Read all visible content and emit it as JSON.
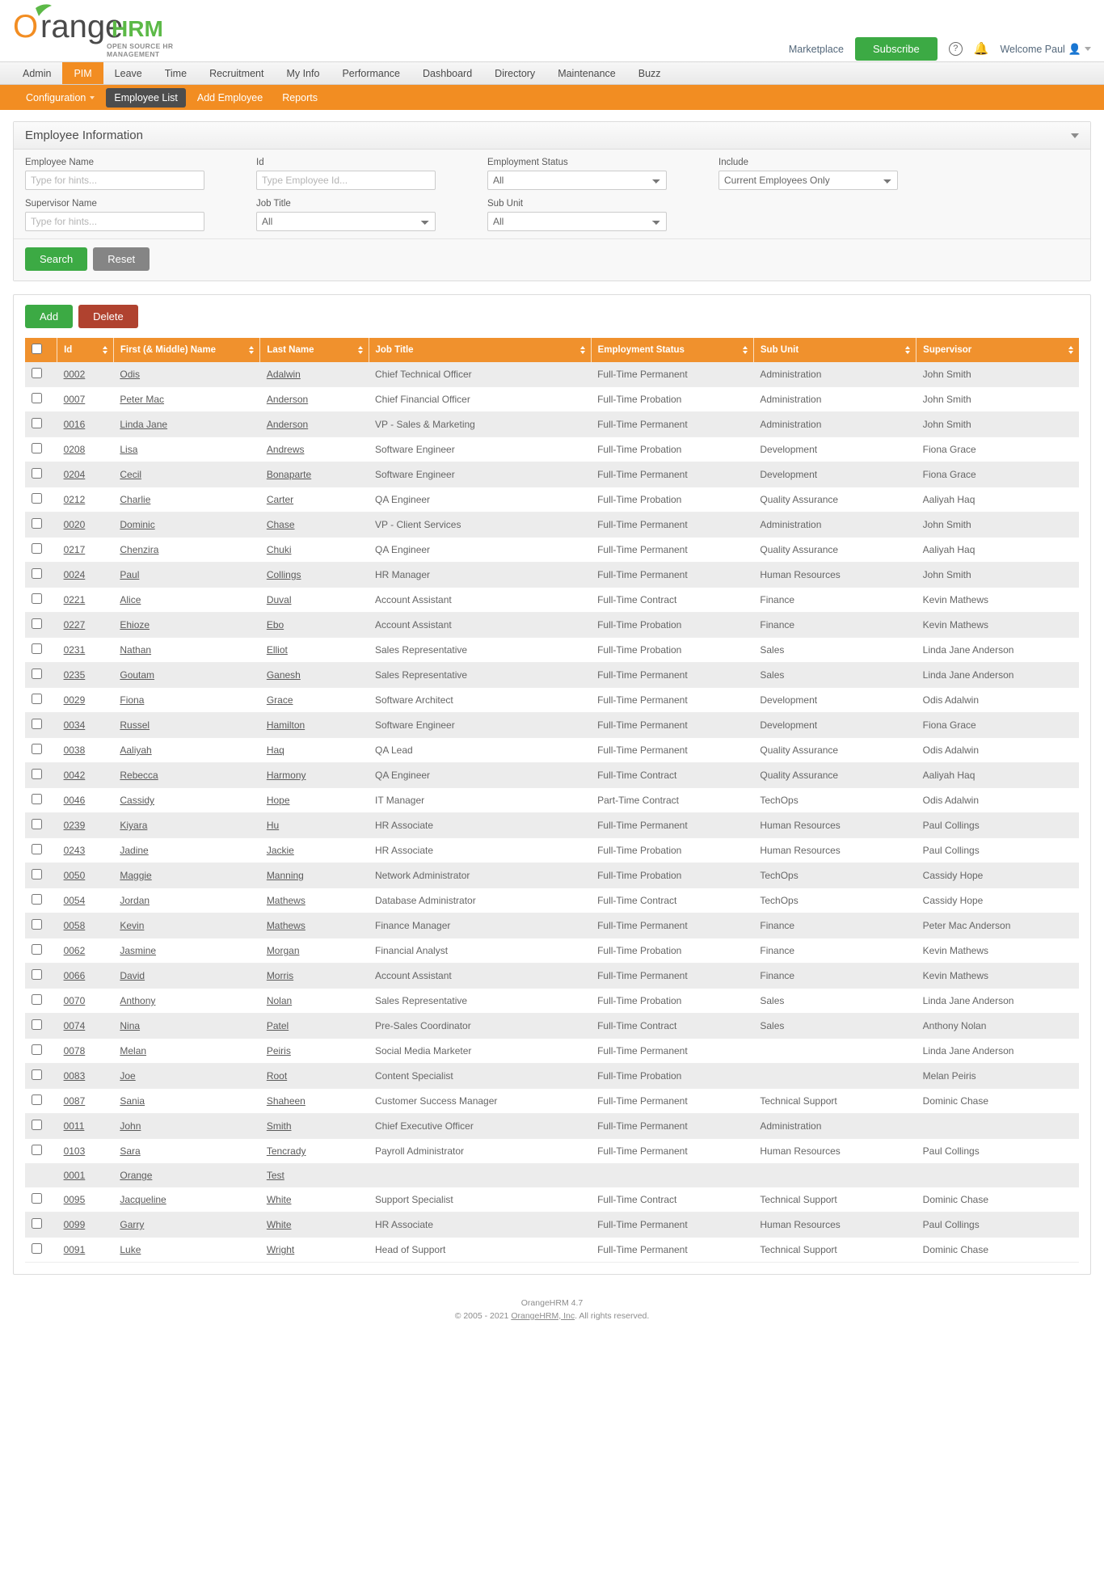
{
  "header": {
    "logo_text_orange": "range",
    "logo_text_o": "O",
    "logo_text_hrm": "HRM",
    "logo_tagline": "OPEN SOURCE HR MANAGEMENT",
    "marketplace": "Marketplace",
    "subscribe": "Subscribe",
    "help_icon": "?",
    "bell_icon": "ὑ4",
    "welcome": "Welcome Paul",
    "colors": {
      "orange": "#f28d22",
      "green": "#3caa44",
      "red": "#b0422f"
    }
  },
  "main_nav": {
    "items": [
      {
        "label": "Admin",
        "active": false
      },
      {
        "label": "PIM",
        "active": true
      },
      {
        "label": "Leave",
        "active": false
      },
      {
        "label": "Time",
        "active": false
      },
      {
        "label": "Recruitment",
        "active": false
      },
      {
        "label": "My Info",
        "active": false
      },
      {
        "label": "Performance",
        "active": false
      },
      {
        "label": "Dashboard",
        "active": false
      },
      {
        "label": "Directory",
        "active": false
      },
      {
        "label": "Maintenance",
        "active": false
      },
      {
        "label": "Buzz",
        "active": false
      }
    ]
  },
  "sub_nav": {
    "items": [
      {
        "label": "Configuration",
        "active": false,
        "caret": true
      },
      {
        "label": "Employee List",
        "active": true,
        "caret": false
      },
      {
        "label": "Add Employee",
        "active": false,
        "caret": false
      },
      {
        "label": "Reports",
        "active": false,
        "caret": false
      }
    ]
  },
  "search_panel": {
    "title": "Employee Information",
    "fields": {
      "employee_name": {
        "label": "Employee Name",
        "placeholder": "Type for hints...",
        "value": ""
      },
      "id": {
        "label": "Id",
        "placeholder": "Type Employee Id...",
        "value": ""
      },
      "employment_status": {
        "label": "Employment Status",
        "value": "All"
      },
      "include": {
        "label": "Include",
        "value": "Current Employees Only"
      },
      "supervisor_name": {
        "label": "Supervisor Name",
        "placeholder": "Type for hints...",
        "value": ""
      },
      "job_title": {
        "label": "Job Title",
        "value": "All"
      },
      "sub_unit": {
        "label": "Sub Unit",
        "value": "All"
      }
    },
    "search_label": "Search",
    "reset_label": "Reset"
  },
  "list_panel": {
    "add_label": "Add",
    "delete_label": "Delete",
    "columns": [
      {
        "key": "check",
        "label": ""
      },
      {
        "key": "id",
        "label": "Id",
        "sortable": true
      },
      {
        "key": "first",
        "label": "First (& Middle) Name",
        "sortable": true
      },
      {
        "key": "last",
        "label": "Last Name",
        "sortable": true
      },
      {
        "key": "job",
        "label": "Job Title",
        "sortable": true
      },
      {
        "key": "employment_status",
        "label": "Employment Status",
        "sortable": true
      },
      {
        "key": "sub_unit",
        "label": "Sub Unit",
        "sortable": true
      },
      {
        "key": "supervisor",
        "label": "Supervisor",
        "sortable": true
      }
    ],
    "rows": [
      {
        "id": "0002",
        "first": "Odis",
        "last": "Adalwin",
        "job": "Chief Technical Officer",
        "employment_status": "Full-Time Permanent",
        "sub_unit": "Administration",
        "supervisor": "John Smith",
        "checkbox": true
      },
      {
        "id": "0007",
        "first": "Peter Mac",
        "last": "Anderson",
        "job": "Chief Financial Officer",
        "employment_status": "Full-Time Probation",
        "sub_unit": "Administration",
        "supervisor": "John Smith",
        "checkbox": true
      },
      {
        "id": "0016",
        "first": "Linda Jane",
        "last": "Anderson",
        "job": "VP - Sales & Marketing",
        "employment_status": "Full-Time Permanent",
        "sub_unit": "Administration",
        "supervisor": "John Smith",
        "checkbox": true
      },
      {
        "id": "0208",
        "first": "Lisa",
        "last": "Andrews",
        "job": "Software Engineer",
        "employment_status": "Full-Time Probation",
        "sub_unit": "Development",
        "supervisor": "Fiona Grace",
        "checkbox": true
      },
      {
        "id": "0204",
        "first": "Cecil",
        "last": "Bonaparte",
        "job": "Software Engineer",
        "employment_status": "Full-Time Permanent",
        "sub_unit": "Development",
        "supervisor": "Fiona Grace",
        "checkbox": true
      },
      {
        "id": "0212",
        "first": "Charlie",
        "last": "Carter",
        "job": "QA Engineer",
        "employment_status": "Full-Time Probation",
        "sub_unit": "Quality Assurance",
        "supervisor": "Aaliyah Haq",
        "checkbox": true
      },
      {
        "id": "0020",
        "first": "Dominic",
        "last": "Chase",
        "job": "VP - Client Services",
        "employment_status": "Full-Time Permanent",
        "sub_unit": "Administration",
        "supervisor": "John Smith",
        "checkbox": true
      },
      {
        "id": "0217",
        "first": "Chenzira",
        "last": "Chuki",
        "job": "QA Engineer",
        "employment_status": "Full-Time Permanent",
        "sub_unit": "Quality Assurance",
        "supervisor": "Aaliyah Haq",
        "checkbox": true
      },
      {
        "id": "0024",
        "first": "Paul",
        "last": "Collings",
        "job": "HR Manager",
        "employment_status": "Full-Time Permanent",
        "sub_unit": "Human Resources",
        "supervisor": "John Smith",
        "checkbox": true
      },
      {
        "id": "0221",
        "first": "Alice",
        "last": "Duval",
        "job": "Account Assistant",
        "employment_status": "Full-Time Contract",
        "sub_unit": "Finance",
        "supervisor": "Kevin Mathews",
        "checkbox": true
      },
      {
        "id": "0227",
        "first": "Ehioze",
        "last": "Ebo",
        "job": "Account Assistant",
        "employment_status": "Full-Time Probation",
        "sub_unit": "Finance",
        "supervisor": "Kevin Mathews",
        "checkbox": true
      },
      {
        "id": "0231",
        "first": "Nathan",
        "last": "Elliot",
        "job": "Sales Representative",
        "employment_status": "Full-Time Probation",
        "sub_unit": "Sales",
        "supervisor": "Linda Jane Anderson",
        "checkbox": true
      },
      {
        "id": "0235",
        "first": "Goutam",
        "last": "Ganesh",
        "job": "Sales Representative",
        "employment_status": "Full-Time Permanent",
        "sub_unit": "Sales",
        "supervisor": "Linda Jane Anderson",
        "checkbox": true
      },
      {
        "id": "0029",
        "first": "Fiona",
        "last": "Grace",
        "job": "Software Architect",
        "employment_status": "Full-Time Permanent",
        "sub_unit": "Development",
        "supervisor": "Odis Adalwin",
        "checkbox": true
      },
      {
        "id": "0034",
        "first": "Russel",
        "last": "Hamilton",
        "job": "Software Engineer",
        "employment_status": "Full-Time Permanent",
        "sub_unit": "Development",
        "supervisor": "Fiona Grace",
        "checkbox": true
      },
      {
        "id": "0038",
        "first": "Aaliyah",
        "last": "Haq",
        "job": "QA Lead",
        "employment_status": "Full-Time Permanent",
        "sub_unit": "Quality Assurance",
        "supervisor": "Odis Adalwin",
        "checkbox": true
      },
      {
        "id": "0042",
        "first": "Rebecca",
        "last": "Harmony",
        "job": "QA Engineer",
        "employment_status": "Full-Time Contract",
        "sub_unit": "Quality Assurance",
        "supervisor": "Aaliyah Haq",
        "checkbox": true
      },
      {
        "id": "0046",
        "first": "Cassidy",
        "last": "Hope",
        "job": "IT Manager",
        "employment_status": "Part-Time Contract",
        "sub_unit": "TechOps",
        "supervisor": "Odis Adalwin",
        "checkbox": true
      },
      {
        "id": "0239",
        "first": "Kiyara",
        "last": "Hu",
        "job": "HR Associate",
        "employment_status": "Full-Time Permanent",
        "sub_unit": "Human Resources",
        "supervisor": "Paul Collings",
        "checkbox": true
      },
      {
        "id": "0243",
        "first": "Jadine",
        "last": "Jackie",
        "job": "HR Associate",
        "employment_status": "Full-Time Probation",
        "sub_unit": "Human Resources",
        "supervisor": "Paul Collings",
        "checkbox": true
      },
      {
        "id": "0050",
        "first": "Maggie",
        "last": "Manning",
        "job": "Network Administrator",
        "employment_status": "Full-Time Probation",
        "sub_unit": "TechOps",
        "supervisor": "Cassidy Hope",
        "checkbox": true
      },
      {
        "id": "0054",
        "first": "Jordan",
        "last": "Mathews",
        "job": "Database Administrator",
        "employment_status": "Full-Time Contract",
        "sub_unit": "TechOps",
        "supervisor": "Cassidy Hope",
        "checkbox": true
      },
      {
        "id": "0058",
        "first": "Kevin",
        "last": "Mathews",
        "job": "Finance Manager",
        "employment_status": "Full-Time Permanent",
        "sub_unit": "Finance",
        "supervisor": "Peter Mac Anderson",
        "checkbox": true
      },
      {
        "id": "0062",
        "first": "Jasmine",
        "last": "Morgan",
        "job": "Financial Analyst",
        "employment_status": "Full-Time Probation",
        "sub_unit": "Finance",
        "supervisor": "Kevin Mathews",
        "checkbox": true
      },
      {
        "id": "0066",
        "first": "David",
        "last": "Morris",
        "job": "Account Assistant",
        "employment_status": "Full-Time Permanent",
        "sub_unit": "Finance",
        "supervisor": "Kevin Mathews",
        "checkbox": true
      },
      {
        "id": "0070",
        "first": "Anthony",
        "last": "Nolan",
        "job": "Sales Representative",
        "employment_status": "Full-Time Probation",
        "sub_unit": "Sales",
        "supervisor": "Linda Jane Anderson",
        "checkbox": true
      },
      {
        "id": "0074",
        "first": "Nina",
        "last": "Patel",
        "job": "Pre-Sales Coordinator",
        "employment_status": "Full-Time Contract",
        "sub_unit": "Sales",
        "supervisor": "Anthony Nolan",
        "checkbox": true
      },
      {
        "id": "0078",
        "first": "Melan",
        "last": "Peiris",
        "job": "Social Media Marketer",
        "employment_status": "Full-Time Permanent",
        "sub_unit": "",
        "supervisor": "Linda Jane Anderson",
        "checkbox": true
      },
      {
        "id": "0083",
        "first": "Joe",
        "last": "Root",
        "job": "Content Specialist",
        "employment_status": "Full-Time Probation",
        "sub_unit": "",
        "supervisor": "Melan Peiris",
        "checkbox": true
      },
      {
        "id": "0087",
        "first": "Sania",
        "last": "Shaheen",
        "job": "Customer Success Manager",
        "employment_status": "Full-Time Permanent",
        "sub_unit": "Technical Support",
        "supervisor": "Dominic Chase",
        "checkbox": true
      },
      {
        "id": "0011",
        "first": "John",
        "last": "Smith",
        "job": "Chief Executive Officer",
        "employment_status": "Full-Time Permanent",
        "sub_unit": "Administration",
        "supervisor": "",
        "checkbox": true
      },
      {
        "id": "0103",
        "first": "Sara",
        "last": "Tencrady",
        "job": "Payroll Administrator",
        "employment_status": "Full-Time Permanent",
        "sub_unit": "Human Resources",
        "supervisor": "Paul Collings",
        "checkbox": true
      },
      {
        "id": "0001",
        "first": "Orange",
        "last": "Test",
        "job": "",
        "employment_status": "",
        "sub_unit": "",
        "supervisor": "",
        "checkbox": false
      },
      {
        "id": "0095",
        "first": "Jacqueline",
        "last": "White",
        "job": "Support Specialist",
        "employment_status": "Full-Time Contract",
        "sub_unit": "Technical Support",
        "supervisor": "Dominic Chase",
        "checkbox": true
      },
      {
        "id": "0099",
        "first": "Garry",
        "last": "White",
        "job": "HR Associate",
        "employment_status": "Full-Time Permanent",
        "sub_unit": "Human Resources",
        "supervisor": "Paul Collings",
        "checkbox": true
      },
      {
        "id": "0091",
        "first": "Luke",
        "last": "Wright",
        "job": "Head of Support",
        "employment_status": "Full-Time Permanent",
        "sub_unit": "Technical Support",
        "supervisor": "Dominic Chase",
        "checkbox": true
      }
    ]
  },
  "footer": {
    "version": "OrangeHRM 4.7",
    "copy_prefix": "© 2005 - 2021 ",
    "copy_link": "OrangeHRM, Inc",
    "copy_suffix": ". All rights reserved."
  }
}
